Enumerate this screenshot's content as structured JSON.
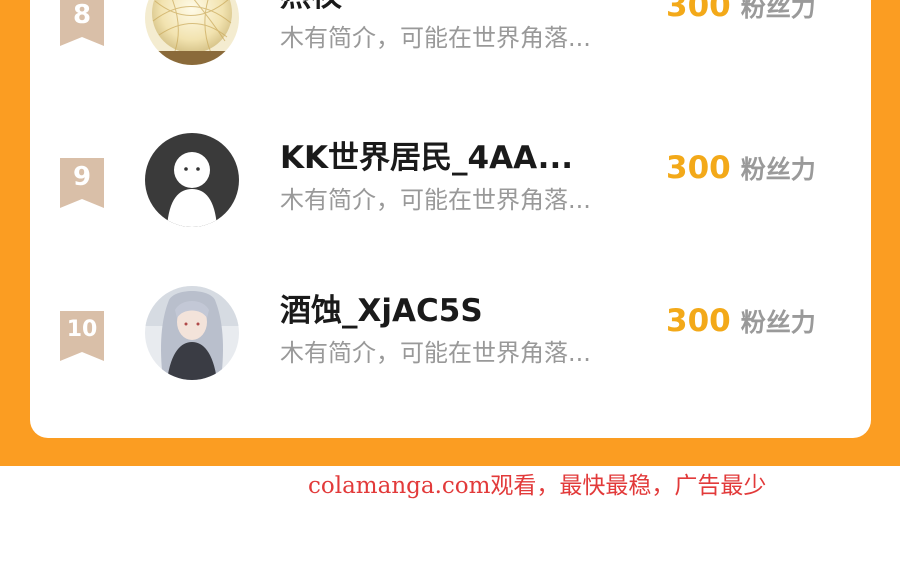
{
  "rows": [
    {
      "rank": "8",
      "name": "燕衩",
      "bio": "木有简介，可能在世界角落...",
      "fans": "300",
      "fans_label": "粉丝力"
    },
    {
      "rank": "9",
      "name": "KK世界居民_4AA...",
      "bio": "木有简介，可能在世界角落...",
      "fans": "300",
      "fans_label": "粉丝力"
    },
    {
      "rank": "10",
      "name": "酒蚀_XjAC5S",
      "bio": "木有简介，可能在世界角落...",
      "fans": "300",
      "fans_label": "粉丝力"
    }
  ],
  "watermark": "colamanga.com观看，最快最稳，广告最少",
  "colors": {
    "orange": "#fb9d22",
    "fans_number": "#f3a919",
    "rank_badge": "#d9bfa8",
    "watermark": "#e23a3a"
  },
  "icons": [
    "rank-ribbon-icon",
    "default-avatar-icon"
  ]
}
